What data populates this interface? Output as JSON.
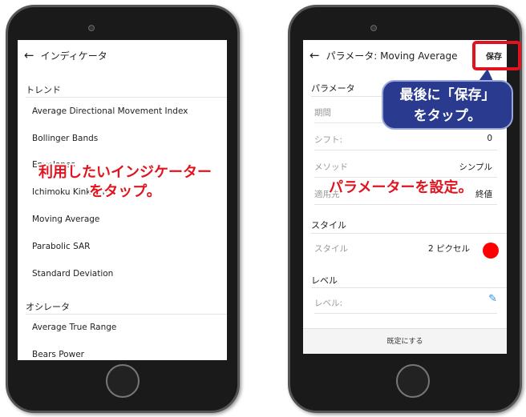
{
  "left": {
    "title": "インディケータ",
    "sections": [
      {
        "label": "トレンド",
        "items": [
          "Average Directional Movement Index",
          "Bollinger Bands",
          "Envelopes",
          "Ichimoku Kinko Hyo",
          "Moving Average",
          "Parabolic SAR",
          "Standard Deviation"
        ]
      },
      {
        "label": "オシレータ",
        "items": [
          "Average True Range",
          "Bears Power"
        ]
      }
    ],
    "annotation_line1": "利用したいインジケーター",
    "annotation_line2": "をタップ。"
  },
  "right": {
    "title": "パラメータ: Moving Average",
    "save_label": "保存",
    "param_section": "パラメータ",
    "rows": [
      {
        "label": "期間",
        "value": ""
      },
      {
        "label": "シフト:",
        "value": "0"
      },
      {
        "label": "メソッド",
        "value": "シンプル"
      },
      {
        "label": "適用先",
        "value": "終値"
      }
    ],
    "style_section": "スタイル",
    "style_label": "スタイル",
    "style_value": "2 ピクセル",
    "style_color": "#ff0000",
    "level_section": "レベル",
    "level_label": "レベル:",
    "footer_button": "既定にする",
    "annotation": "パラメーターを設定。",
    "callout_line1": "最後に「保存」",
    "callout_line2": "をタップ。"
  },
  "colors": {
    "annotation": "#e0141e",
    "callout": "#2a3a8f",
    "highlight": "#e0141e",
    "edit_icon": "#2a90d8"
  }
}
